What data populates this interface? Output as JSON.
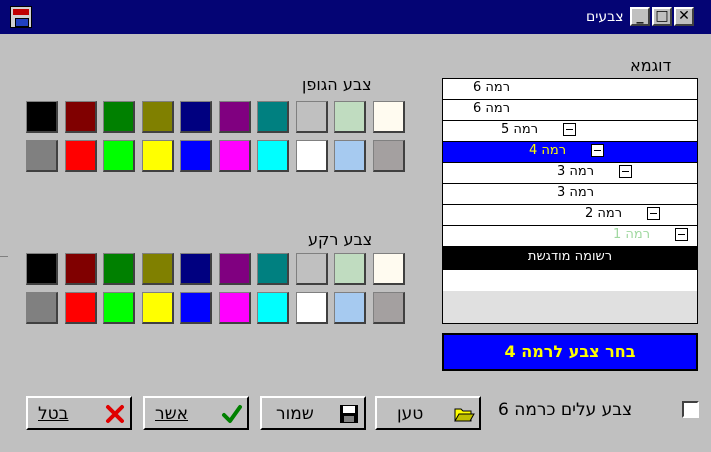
{
  "window": {
    "title": "צבעים"
  },
  "labels": {
    "body_color": "צבע הגופן",
    "bg_color": "צבע רקע",
    "sample": "דוגמא"
  },
  "palette": {
    "row1": [
      "#000000",
      "#800000",
      "#008000",
      "#808000",
      "#000080",
      "#800080",
      "#008080",
      "#c0c0c0",
      "#c0dcc0",
      "#fffbf0"
    ],
    "row2": [
      "#808080",
      "#ff0000",
      "#00ff00",
      "#ffff00",
      "#0000ff",
      "#ff00ff",
      "#00ffff",
      "#ffffff",
      "#a6caf0",
      "#a4a0a0"
    ]
  },
  "sample_rows": [
    {
      "text": "רמה 6",
      "bg": "#ffffff",
      "fg": "#000000",
      "indent": 0,
      "minus": false
    },
    {
      "text": "רמה 6",
      "bg": "#ffffff",
      "fg": "#000000",
      "indent": 0,
      "minus": false
    },
    {
      "text": "רמה 5",
      "bg": "#ffffff",
      "fg": "#000000",
      "indent": 1,
      "minus": true
    },
    {
      "text": "רמה 4",
      "bg": "#0000ff",
      "fg": "#ffff00",
      "indent": 2,
      "minus": true
    },
    {
      "text": "רמה 3",
      "bg": "#ffffff",
      "fg": "#000000",
      "indent": 3,
      "minus": true
    },
    {
      "text": "רמה 3",
      "bg": "#ffffff",
      "fg": "#000000",
      "indent": 3,
      "minus": false
    },
    {
      "text": "רמה 2",
      "bg": "#ffffff",
      "fg": "#000000",
      "indent": 4,
      "minus": true
    },
    {
      "text": "רמה 1",
      "bg": "#ffffff",
      "fg": "#a0d8a0",
      "indent": 5,
      "minus": true
    },
    {
      "text": "רשומה מודגשת",
      "bg": "#000000",
      "fg": "#ffffff",
      "indent": 0,
      "minus": false
    }
  ],
  "pick_level": "בחר צבע לרמה 4",
  "buttons": {
    "cancel": "בטל",
    "confirm": "אשר",
    "save": "שמור",
    "load": "טען"
  },
  "checkbox": {
    "label": "צבע עלים כרמה 6",
    "checked": false
  }
}
